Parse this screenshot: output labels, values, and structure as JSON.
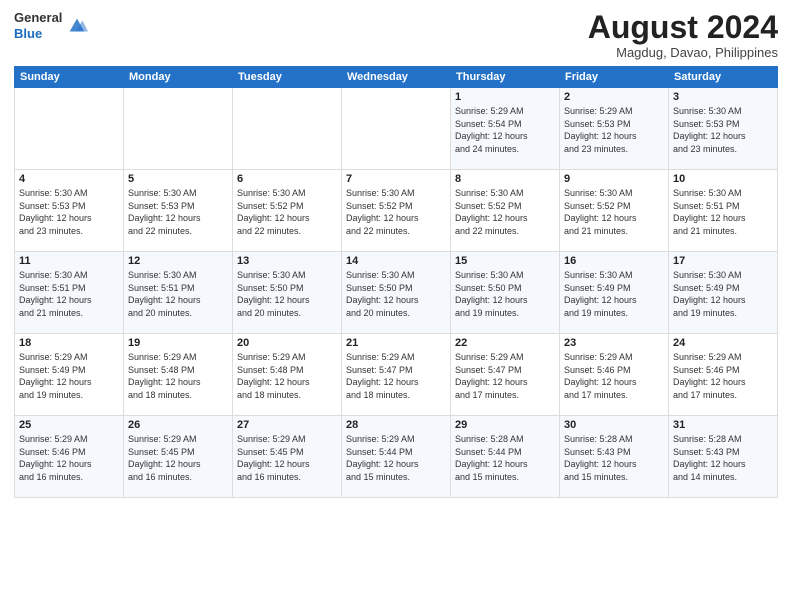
{
  "header": {
    "logo_general": "General",
    "logo_blue": "Blue",
    "month_title": "August 2024",
    "location": "Magdug, Davao, Philippines"
  },
  "weekdays": [
    "Sunday",
    "Monday",
    "Tuesday",
    "Wednesday",
    "Thursday",
    "Friday",
    "Saturday"
  ],
  "weeks": [
    [
      {
        "day": "",
        "info": ""
      },
      {
        "day": "",
        "info": ""
      },
      {
        "day": "",
        "info": ""
      },
      {
        "day": "",
        "info": ""
      },
      {
        "day": "1",
        "info": "Sunrise: 5:29 AM\nSunset: 5:54 PM\nDaylight: 12 hours\nand 24 minutes."
      },
      {
        "day": "2",
        "info": "Sunrise: 5:29 AM\nSunset: 5:53 PM\nDaylight: 12 hours\nand 23 minutes."
      },
      {
        "day": "3",
        "info": "Sunrise: 5:30 AM\nSunset: 5:53 PM\nDaylight: 12 hours\nand 23 minutes."
      }
    ],
    [
      {
        "day": "4",
        "info": "Sunrise: 5:30 AM\nSunset: 5:53 PM\nDaylight: 12 hours\nand 23 minutes."
      },
      {
        "day": "5",
        "info": "Sunrise: 5:30 AM\nSunset: 5:53 PM\nDaylight: 12 hours\nand 22 minutes."
      },
      {
        "day": "6",
        "info": "Sunrise: 5:30 AM\nSunset: 5:52 PM\nDaylight: 12 hours\nand 22 minutes."
      },
      {
        "day": "7",
        "info": "Sunrise: 5:30 AM\nSunset: 5:52 PM\nDaylight: 12 hours\nand 22 minutes."
      },
      {
        "day": "8",
        "info": "Sunrise: 5:30 AM\nSunset: 5:52 PM\nDaylight: 12 hours\nand 22 minutes."
      },
      {
        "day": "9",
        "info": "Sunrise: 5:30 AM\nSunset: 5:52 PM\nDaylight: 12 hours\nand 21 minutes."
      },
      {
        "day": "10",
        "info": "Sunrise: 5:30 AM\nSunset: 5:51 PM\nDaylight: 12 hours\nand 21 minutes."
      }
    ],
    [
      {
        "day": "11",
        "info": "Sunrise: 5:30 AM\nSunset: 5:51 PM\nDaylight: 12 hours\nand 21 minutes."
      },
      {
        "day": "12",
        "info": "Sunrise: 5:30 AM\nSunset: 5:51 PM\nDaylight: 12 hours\nand 20 minutes."
      },
      {
        "day": "13",
        "info": "Sunrise: 5:30 AM\nSunset: 5:50 PM\nDaylight: 12 hours\nand 20 minutes."
      },
      {
        "day": "14",
        "info": "Sunrise: 5:30 AM\nSunset: 5:50 PM\nDaylight: 12 hours\nand 20 minutes."
      },
      {
        "day": "15",
        "info": "Sunrise: 5:30 AM\nSunset: 5:50 PM\nDaylight: 12 hours\nand 19 minutes."
      },
      {
        "day": "16",
        "info": "Sunrise: 5:30 AM\nSunset: 5:49 PM\nDaylight: 12 hours\nand 19 minutes."
      },
      {
        "day": "17",
        "info": "Sunrise: 5:30 AM\nSunset: 5:49 PM\nDaylight: 12 hours\nand 19 minutes."
      }
    ],
    [
      {
        "day": "18",
        "info": "Sunrise: 5:29 AM\nSunset: 5:49 PM\nDaylight: 12 hours\nand 19 minutes."
      },
      {
        "day": "19",
        "info": "Sunrise: 5:29 AM\nSunset: 5:48 PM\nDaylight: 12 hours\nand 18 minutes."
      },
      {
        "day": "20",
        "info": "Sunrise: 5:29 AM\nSunset: 5:48 PM\nDaylight: 12 hours\nand 18 minutes."
      },
      {
        "day": "21",
        "info": "Sunrise: 5:29 AM\nSunset: 5:47 PM\nDaylight: 12 hours\nand 18 minutes."
      },
      {
        "day": "22",
        "info": "Sunrise: 5:29 AM\nSunset: 5:47 PM\nDaylight: 12 hours\nand 17 minutes."
      },
      {
        "day": "23",
        "info": "Sunrise: 5:29 AM\nSunset: 5:46 PM\nDaylight: 12 hours\nand 17 minutes."
      },
      {
        "day": "24",
        "info": "Sunrise: 5:29 AM\nSunset: 5:46 PM\nDaylight: 12 hours\nand 17 minutes."
      }
    ],
    [
      {
        "day": "25",
        "info": "Sunrise: 5:29 AM\nSunset: 5:46 PM\nDaylight: 12 hours\nand 16 minutes."
      },
      {
        "day": "26",
        "info": "Sunrise: 5:29 AM\nSunset: 5:45 PM\nDaylight: 12 hours\nand 16 minutes."
      },
      {
        "day": "27",
        "info": "Sunrise: 5:29 AM\nSunset: 5:45 PM\nDaylight: 12 hours\nand 16 minutes."
      },
      {
        "day": "28",
        "info": "Sunrise: 5:29 AM\nSunset: 5:44 PM\nDaylight: 12 hours\nand 15 minutes."
      },
      {
        "day": "29",
        "info": "Sunrise: 5:28 AM\nSunset: 5:44 PM\nDaylight: 12 hours\nand 15 minutes."
      },
      {
        "day": "30",
        "info": "Sunrise: 5:28 AM\nSunset: 5:43 PM\nDaylight: 12 hours\nand 15 minutes."
      },
      {
        "day": "31",
        "info": "Sunrise: 5:28 AM\nSunset: 5:43 PM\nDaylight: 12 hours\nand 14 minutes."
      }
    ]
  ]
}
